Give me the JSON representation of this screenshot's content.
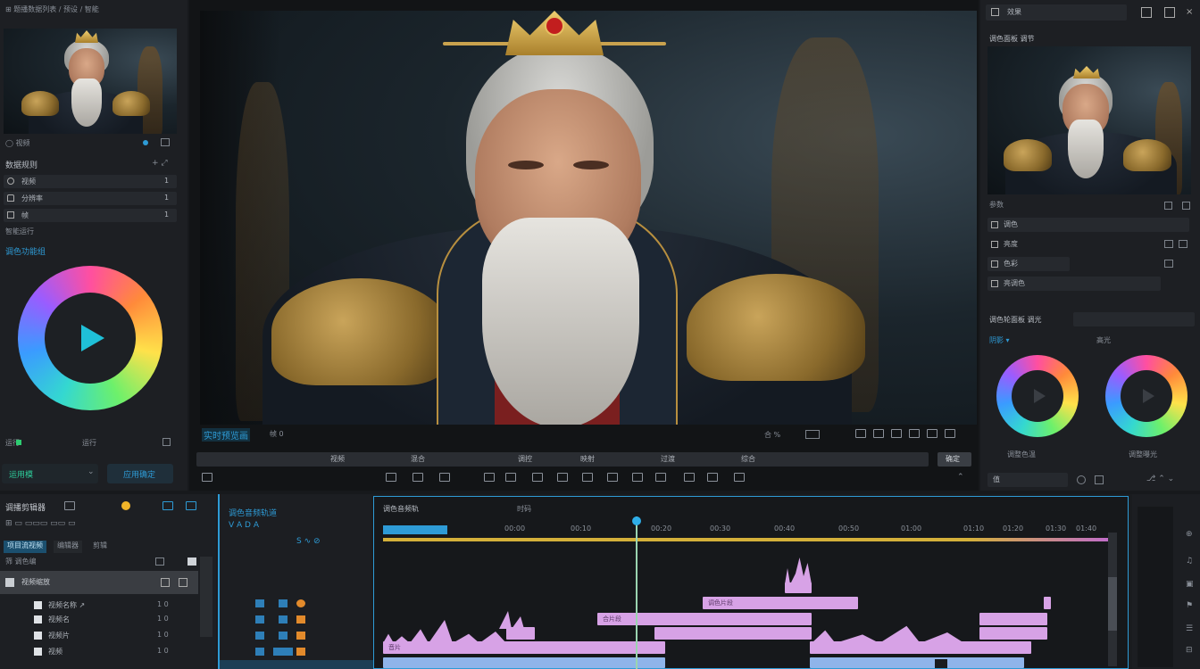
{
  "left_panel": {
    "header_title": "⊞ 题播数据列表 / 预设 / 智能",
    "preview_thumb_caption": "◯ 视频",
    "section_title": "数据规则",
    "properties": [
      {
        "label": "视频",
        "value": "1"
      },
      {
        "label": "分辨率",
        "value": "1"
      },
      {
        "label": "帧",
        "value": "1"
      }
    ],
    "tag_label": "智能运行",
    "color_section_title": "调色功能组",
    "bottom_left_label": "运行",
    "bottom_right_label": "运行",
    "mode_button": "运用模",
    "apply_button": "应用确定"
  },
  "viewer": {
    "status_label": "实时预览画",
    "timecode_short": "帧 0",
    "ratio_label": "合 %",
    "frame_rate_label": "日",
    "scrub_labels": [
      "视频",
      "混合",
      "调控",
      "映射",
      "过渡",
      "综合"
    ],
    "scrub_button": "确定",
    "tool_icons": [
      "cut-icon",
      "crop-icon",
      "mask-icon",
      "pen-icon",
      "grid-icon",
      "speed-icon",
      "frame-icon",
      "audio-icon",
      "trim-icon",
      "check-icon",
      "mark-icon",
      "camera-icon",
      "ripple-icon",
      "lock-icon"
    ]
  },
  "right_panel": {
    "header_title": "效果",
    "source_title": "调色面板 调节",
    "preview_caption": "参数",
    "rows": [
      {
        "label": "调色"
      },
      {
        "label": "亮度"
      },
      {
        "label": "色彩"
      },
      {
        "label": "亮调色"
      }
    ],
    "wheel_section_title": "调色轮面板 调光",
    "wheel_left_title": "阴影 ▾",
    "wheel_right_title": "高光",
    "wheel_left_caption": "调整色温",
    "wheel_right_caption": "调整曝光",
    "bottom_field": "值"
  },
  "timeline": {
    "project_title": "调播剪辑器",
    "tabs": [
      "项目流视频",
      "编辑器",
      "剪辑"
    ],
    "filter_label": "筛 调色编",
    "list_header": "视频缩放",
    "list_items": [
      {
        "name": "视频名称 ↗",
        "value": "1 0"
      },
      {
        "name": "视频名",
        "value": "1 0"
      },
      {
        "name": "视频片",
        "value": "1 0"
      },
      {
        "name": "视频",
        "value": "1 0"
      }
    ],
    "track_header_title": "调色音频轨道",
    "track_header_sub": "V A D A",
    "tracks_title": "调色音频轨",
    "tracks_sub": "时码",
    "ruler_labels": [
      "00:00",
      "00:10",
      "00:20",
      "00:30",
      "00:40",
      "00:50",
      "01:00",
      "01:10",
      "01:20",
      "01:30",
      "01:40"
    ],
    "clip_labels": [
      "调色片段",
      "合片段",
      "音片"
    ]
  },
  "playhead_fraction": 0.347,
  "colors": {
    "accent": "#2e9bd6",
    "clip_pink": "#d7a2e6",
    "clip_blue": "#8fb4ea",
    "ruler_bar": "#d4b03a"
  }
}
